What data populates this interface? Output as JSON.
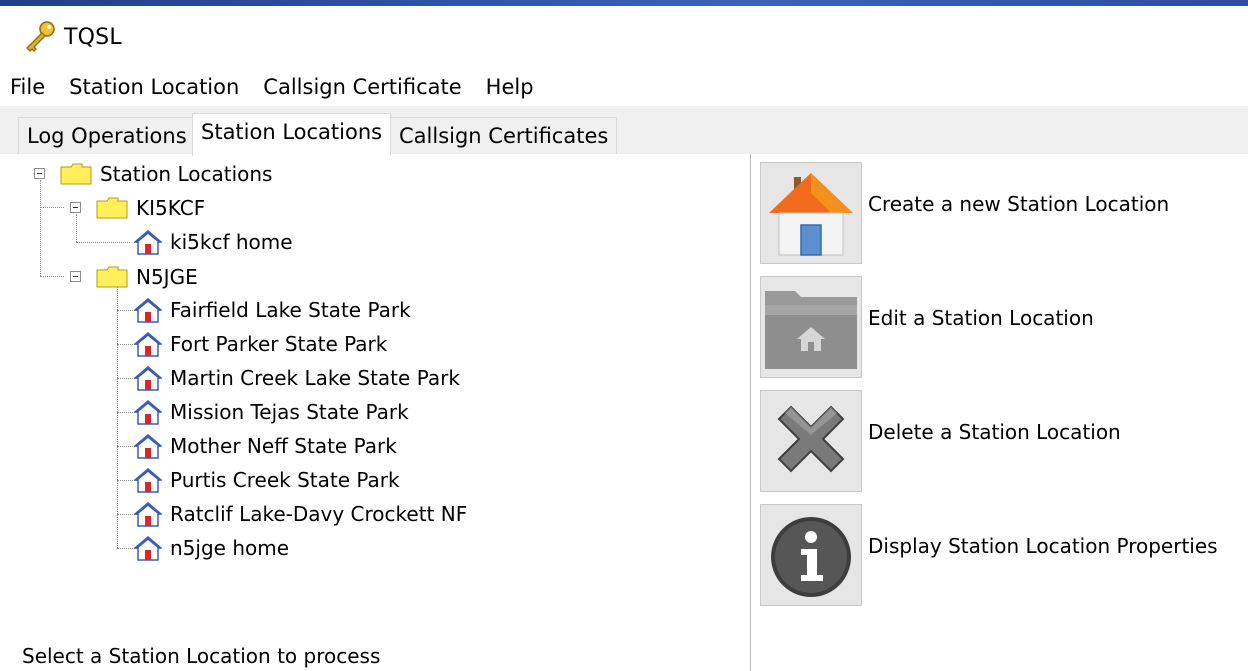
{
  "window": {
    "title": "TQSL"
  },
  "menu": [
    "File",
    "Station Location",
    "Callsign Certificate",
    "Help"
  ],
  "tabs": [
    {
      "label": "Log Operations"
    },
    {
      "label": "Station Locations"
    },
    {
      "label": "Callsign Certificates"
    }
  ],
  "active_tab": "Station Locations",
  "tree": {
    "root": "Station Locations",
    "groups": [
      {
        "label": "KI5KCF",
        "items": [
          "ki5kcf home"
        ]
      },
      {
        "label": "N5JGE",
        "items": [
          "Fairfield Lake State Park",
          "Fort Parker State Park",
          "Martin Creek Lake State Park",
          "Mission Tejas State Park",
          "Mother Neff State Park",
          "Purtis Creek State Park",
          "Ratclif Lake-Davy Crockett NF",
          "n5jge home"
        ]
      }
    ]
  },
  "status": "Select a Station Location to process",
  "actions": [
    {
      "label": "Create a new Station Location",
      "icon": "house-add-icon"
    },
    {
      "label": "Edit a Station Location",
      "icon": "folder-house-icon"
    },
    {
      "label": "Delete a Station Location",
      "icon": "delete-x-icon"
    },
    {
      "label": "Display Station Location Properties",
      "icon": "info-icon"
    }
  ],
  "colors": {
    "folder": "#ffef5a",
    "house_roof": "#3b5db5",
    "house_door": "#d9262b",
    "title_strip": "#2b4f9e"
  }
}
